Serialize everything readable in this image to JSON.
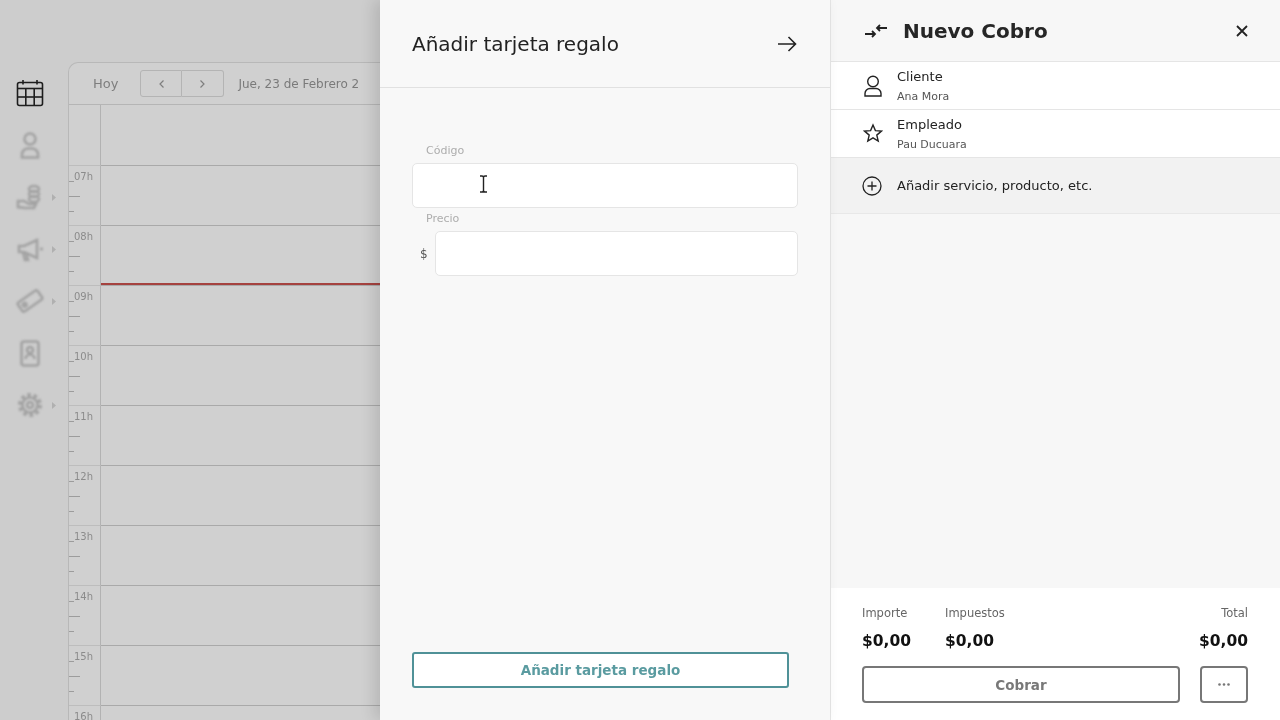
{
  "sidebar": {
    "items": [
      {
        "selected": true,
        "expandable": false
      },
      {
        "selected": false,
        "expandable": false
      },
      {
        "selected": false,
        "expandable": true
      },
      {
        "selected": false,
        "expandable": true
      },
      {
        "selected": false,
        "expandable": true
      },
      {
        "selected": false,
        "expandable": false
      },
      {
        "selected": false,
        "expandable": true
      }
    ]
  },
  "calendar": {
    "today_button": "Hoy",
    "date": "Jue, 23 de Febrero 2",
    "hours": [
      {
        "label": "07h",
        "current": false
      },
      {
        "label": "08h",
        "current": true
      },
      {
        "label": "09h",
        "current": false
      },
      {
        "label": "10h",
        "current": false
      },
      {
        "label": "11h",
        "current": false
      },
      {
        "label": "12h",
        "current": false
      },
      {
        "label": "13h",
        "current": false
      },
      {
        "label": "14h",
        "current": false
      },
      {
        "label": "15h",
        "current": false
      },
      {
        "label": "16h",
        "current": false
      }
    ]
  },
  "gift_card_form": {
    "title": "Añadir tarjeta regalo",
    "fields": [
      {
        "label": "Código"
      },
      {
        "label": "Precio",
        "prefix": "$"
      }
    ],
    "submit_button": "Añadir tarjeta regalo"
  },
  "charge": {
    "title": "Nuevo Cobro",
    "rows": [
      {
        "label": "Cliente",
        "value": "Ana Mora"
      },
      {
        "label": "Empleado",
        "value": "Pau Ducuara"
      }
    ],
    "add_item": "Añadir servicio, producto, etc.",
    "totals": [
      {
        "label": "Importe",
        "value": "$0,00"
      },
      {
        "label": "Impuestos",
        "value": "$0,00"
      },
      {
        "label": "Total",
        "value": "$0,00"
      }
    ],
    "charge_button": "Cobrar"
  }
}
